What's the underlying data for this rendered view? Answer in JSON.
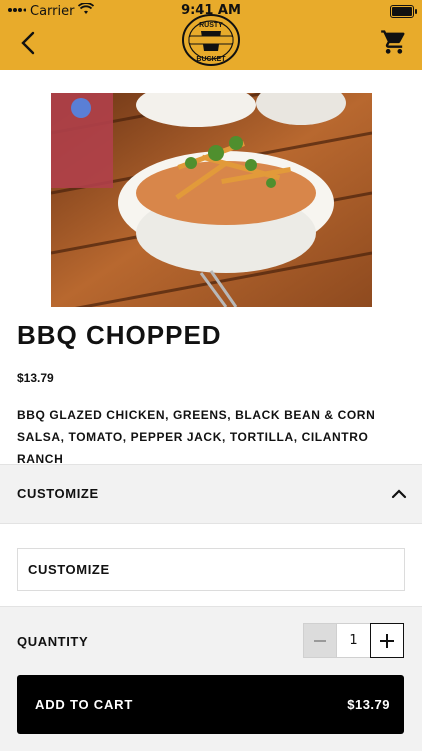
{
  "status_bar": {
    "carrier": "Carrier",
    "time": "9:41 AM"
  },
  "nav": {
    "logo_text_top": "RUSTY",
    "logo_text_bottom": "BUCKET",
    "back_icon": "chevron-left-icon",
    "cart_icon": "cart-icon"
  },
  "product": {
    "title": "BBQ CHOPPED",
    "price": "$13.79",
    "description": "BBQ GLAZED CHICKEN, GREENS, BLACK BEAN & CORN SALSA, TOMATO, PEPPER JACK, TORTILLA, CILANTRO RANCH"
  },
  "customize": {
    "section_label": "CUSTOMIZE",
    "option_label": "CUSTOMIZE",
    "expanded": true
  },
  "quantity": {
    "label": "QUANTITY",
    "value": "1"
  },
  "add_to_cart": {
    "label": "ADD TO CART",
    "price": "$13.79"
  },
  "colors": {
    "brand": "#e8ab2b",
    "button": "#000000",
    "section_bg": "#f2f2f2"
  }
}
